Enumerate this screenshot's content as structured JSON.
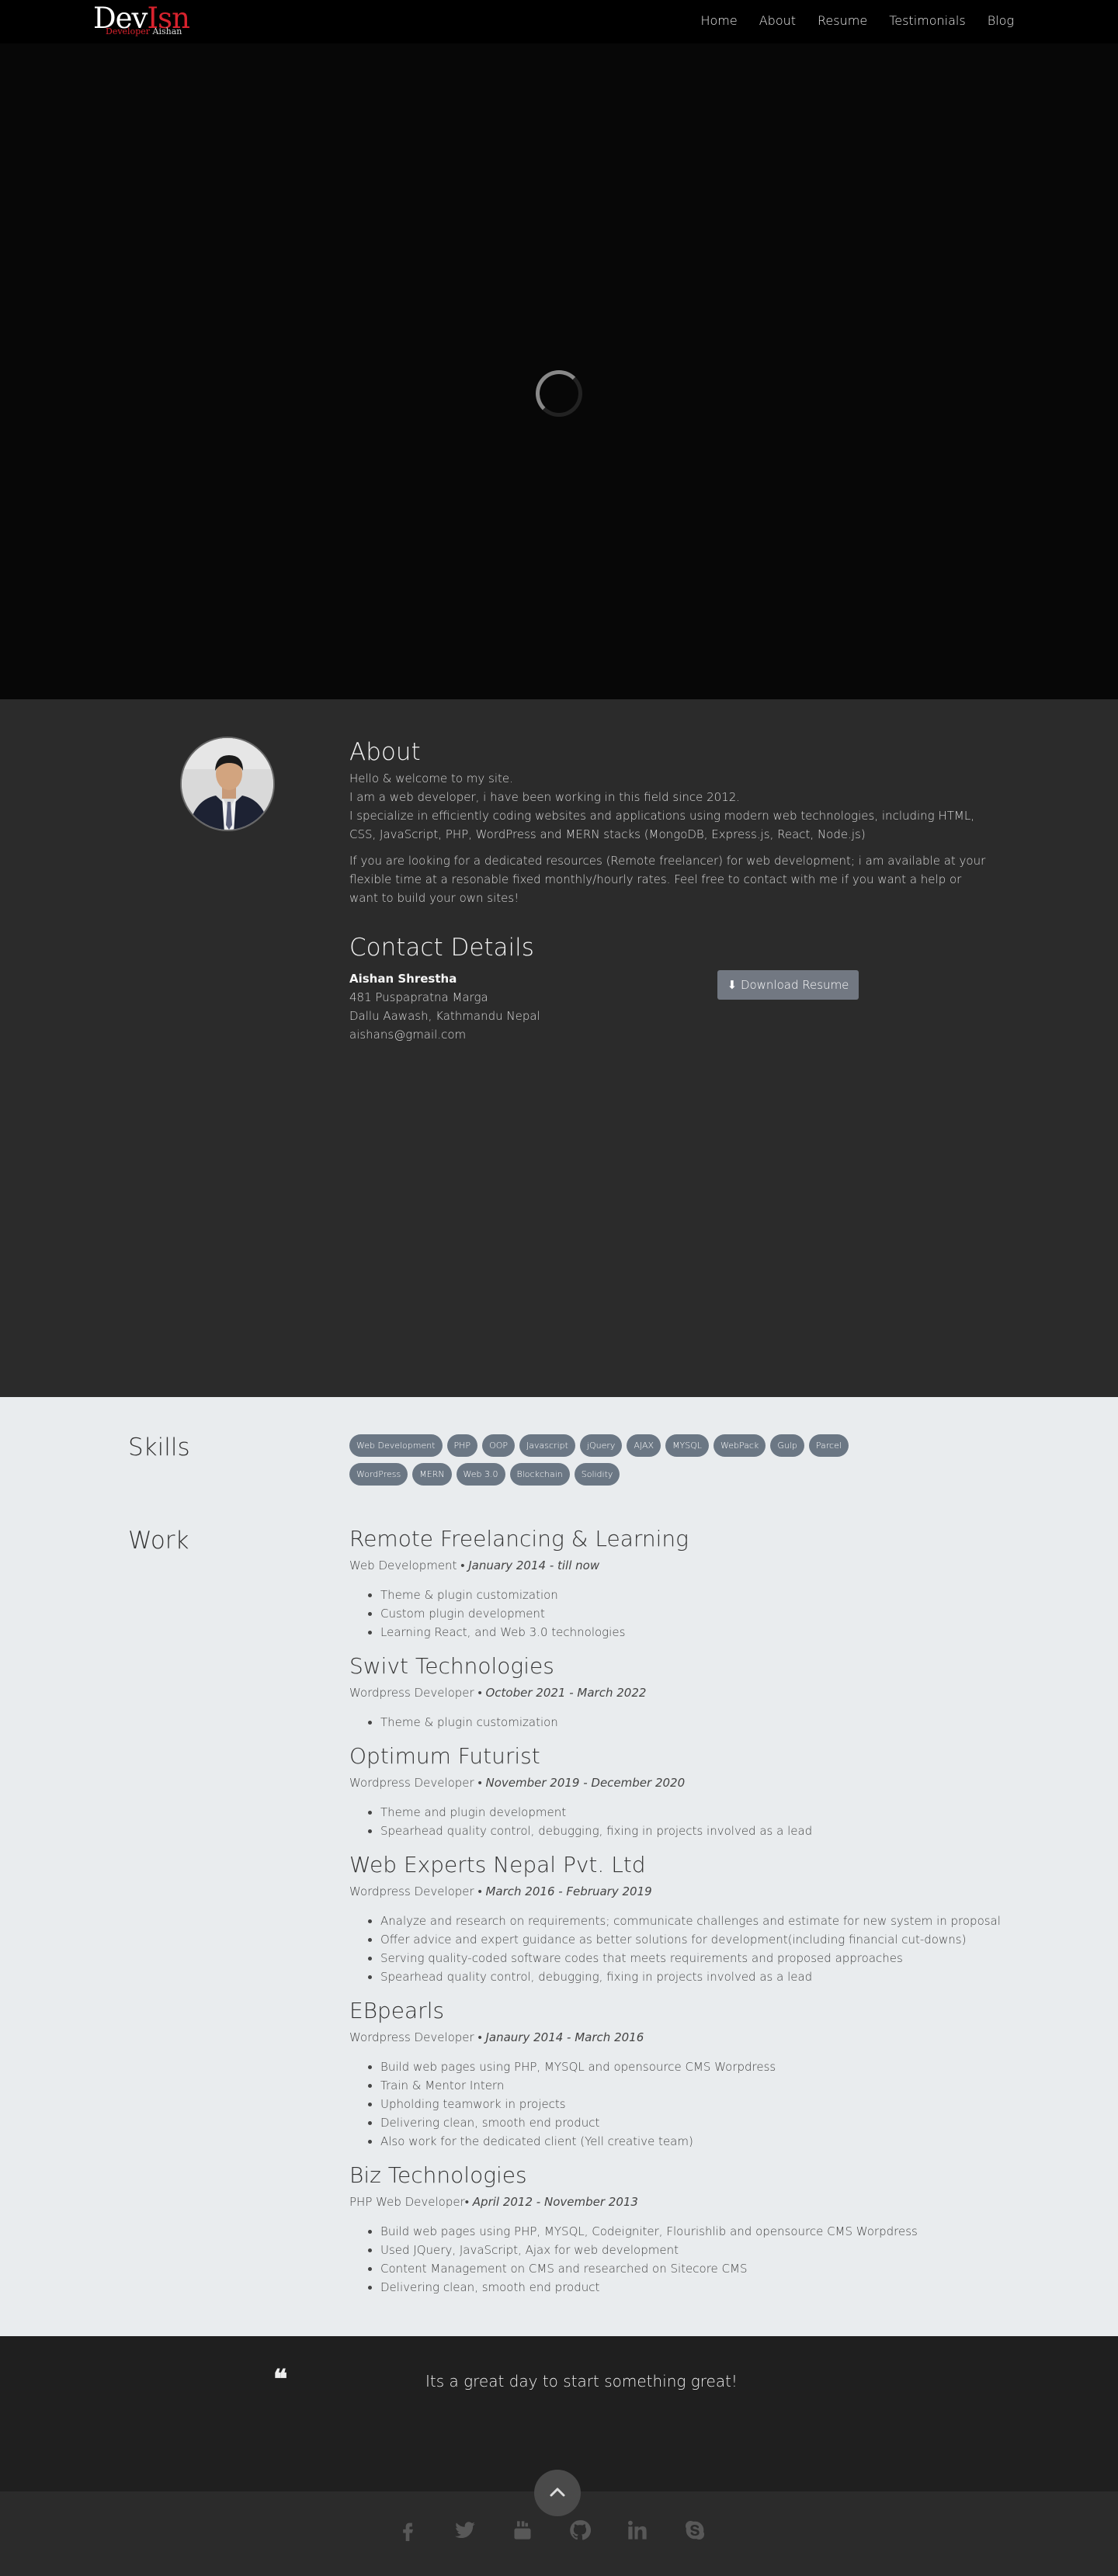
{
  "header": {
    "logo_dev": "Dev",
    "logo_isn": "Isn",
    "logo_sub_red": "Developer",
    "logo_sub_white": "Aishan",
    "nav": [
      "Home",
      "About",
      "Resume",
      "Testimonials",
      "Blog"
    ]
  },
  "about": {
    "title": "About",
    "intro": "Hello & welcome to my site.",
    "line2": "I am a web developer, i have been working in this field since 2012.",
    "line3": "I specialize in efficiently coding websites and applications using modern web technologies, including HTML, CSS, JavaScript, PHP, WordPress and MERN stacks (MongoDB, Express.js, React, Node.js)",
    "para2": "If you are looking for a dedicated resources (Remote freelancer) for web development; i am available at your flexible time at a resonable fixed monthly/hourly rates. Feel free to contact with me if you want a help or want to build your own sites!",
    "contact_title": "Contact Details",
    "name": "Aishan Shrestha",
    "address1": "481 Puspapratna Marga",
    "address2": "Dallu Aawash, Kathmandu Nepal",
    "email": "aishans@gmail.com",
    "download_label": "Download Resume"
  },
  "resume": {
    "skills_label": "Skills",
    "skills": [
      "Web Development",
      "PHP",
      "OOP",
      "Javascript",
      "jQuery",
      "AJAX",
      "MYSQL",
      "WebPack",
      "Gulp",
      "Parcel",
      "WordPress",
      "MERN",
      "Web 3.0",
      "Blockchain",
      "Solidity"
    ],
    "work_label": "Work",
    "jobs": [
      {
        "title": "Remote Freelancing & Learning",
        "role": "Web Development",
        "sep": " • ",
        "date": "January 2014 - till now",
        "items": [
          "Theme & plugin customization",
          "Custom plugin development",
          "Learning React, and Web 3.0 technologies"
        ]
      },
      {
        "title": "Swivt Technologies",
        "role": "Wordpress Developer",
        "sep": " • ",
        "date": "October 2021 - March 2022",
        "items": [
          "Theme & plugin customization"
        ]
      },
      {
        "title": "Optimum Futurist",
        "role": "Wordpress Developer",
        "sep": " • ",
        "date": "November 2019 - December 2020",
        "items": [
          "Theme and plugin development",
          "Spearhead quality control, debugging, fixing in projects involved as a lead"
        ]
      },
      {
        "title": "Web Experts Nepal Pvt. Ltd",
        "role": "Wordpress Developer",
        "sep": " • ",
        "date": "March 2016 - February 2019",
        "items": [
          "Analyze and research on requirements; communicate challenges and estimate for new system in proposal",
          "Offer advice and expert guidance as better solutions for development(including financial cut-downs)",
          "Serving quality-coded software codes that meets requirements and proposed approaches",
          "Spearhead quality control, debugging, fixing in projects involved as a lead"
        ]
      },
      {
        "title": "EBpearls",
        "role": "Wordpress Developer",
        "sep": " • ",
        "date": "Janaury 2014 - March 2016",
        "items": [
          "Build web pages using PHP, MYSQL and opensource CMS Worpdress",
          "Train & Mentor Intern",
          "Upholding teamwork in projects",
          "Delivering clean, smooth end product",
          "Also work for the dedicated client (Yell creative team)"
        ]
      },
      {
        "title": "Biz Technologies",
        "role": "PHP Web Developer",
        "sep": "• ",
        "date": "April 2012 - November 2013",
        "items": [
          "Build web pages using PHP, MYSQL, Codeigniter, Flourishlib and opensource CMS Worpdress",
          "Used JQuery, JavaScript, Ajax for web development",
          "Content Management on CMS and researched on Sitecore CMS",
          "Delivering clean, smooth end product"
        ]
      }
    ]
  },
  "quote": {
    "text": "Its a great day to start something great!"
  },
  "footer": {
    "socials": [
      "facebook-icon",
      "twitter-icon",
      "youtube-icon",
      "github-icon",
      "linkedin-icon",
      "skype-icon"
    ]
  },
  "colors": {
    "brand_red": "#d8222d",
    "skill_badge": "#6b7784",
    "button": "#727882"
  }
}
